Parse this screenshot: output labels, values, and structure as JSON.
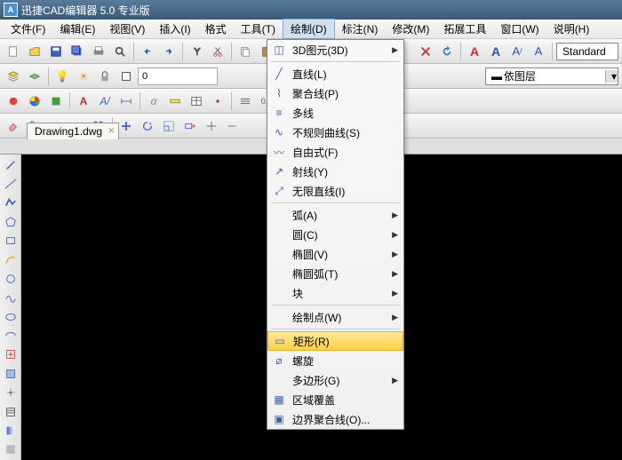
{
  "title": "迅捷CAD编辑器 5.0 专业版",
  "menu": {
    "file": "文件(F)",
    "edit": "编辑(E)",
    "view": "视图(V)",
    "insert": "插入(I)",
    "format": "格式",
    "tools": "工具(T)",
    "draw": "绘制(D)",
    "annotate": "标注(N)",
    "modify": "修改(M)",
    "ext": "拓展工具",
    "window": "窗口(W)",
    "help": "说明(H)"
  },
  "layer_input": "0",
  "style_combo": "Standard",
  "layer_combo": "依图层",
  "tab_name": "Drawing1.dwg",
  "dd": {
    "view3d": "3D图元(3D)",
    "line": "直线(L)",
    "polyline": "聚合线(P)",
    "mline": "多线",
    "spline": "不规则曲线(S)",
    "freeform": "自由式(F)",
    "ray": "射线(Y)",
    "xline": "无限直线(I)",
    "arc": "弧(A)",
    "circle": "圆(C)",
    "ellipse": "椭圆(V)",
    "earc": "椭圆弧(T)",
    "block": "块",
    "drawpt": "绘制点(W)",
    "rect": "矩形(R)",
    "helix": "螺旋",
    "polygon": "多边形(G)",
    "wipeout": "区域覆盖",
    "boundary": "边界聚合线(O)..."
  }
}
